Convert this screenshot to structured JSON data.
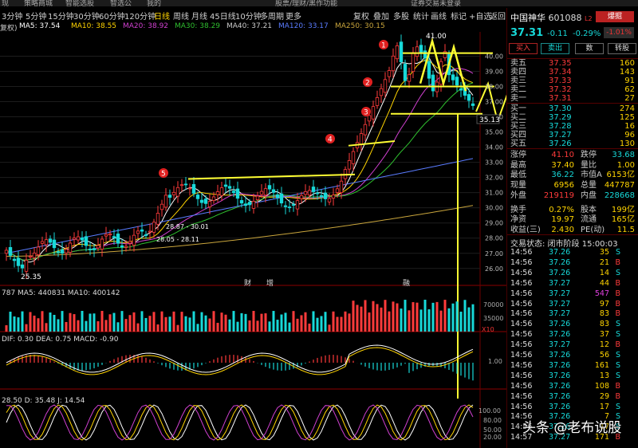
{
  "top_menu": [
    "现",
    "策略商城",
    "智能选股",
    "智选公",
    "我的",
    "股票/理财/黑作功能",
    "证券交易未登录"
  ],
  "periods": [
    "3分钟",
    "5分钟",
    "15分钟",
    "30分钟",
    "60分钟",
    "120分钟",
    "日线",
    "周线",
    "月线",
    "45日线",
    "10分钟",
    "多周期",
    "更多"
  ],
  "periods_active": "日线",
  "tools": [
    "复权",
    "叠加",
    "多股",
    "统计",
    "画线",
    "标记",
    "+自选",
    "返回"
  ],
  "ma_line": {
    "fuquan": "复权)",
    "ma5": "MA5: 37.54",
    "ma10": "MA10: 38.55",
    "ma20": "MA20: 38.92",
    "ma30": "MA30: 38.29",
    "ma40": "MA40: 37.21",
    "ma120": "MA120: 33.17",
    "ma250": "MA250: 30.15"
  },
  "chart": {
    "price_axis": [
      "40.00",
      "39.00",
      "38.00",
      "37.00",
      "36.00",
      "35.00",
      "34.00",
      "33.00",
      "32.00",
      "31.00",
      "30.00",
      "29.00",
      "28.00",
      "27.00",
      "26.00"
    ],
    "current_price_tag": "35.13",
    "high_label": "41.00",
    "low_label": "25.35",
    "range_label_1": "28.87 - 30.01",
    "range_label_2": "28.05 - 28.11",
    "event_labels": [
      "财",
      "增",
      "融"
    ],
    "markers": [
      "1",
      "2",
      "3",
      "4",
      "5"
    ],
    "vol_header": "787  MA5: 440831  MA10: 400142",
    "vol_axis": [
      "70000",
      "35000",
      "X10"
    ],
    "macd_header": "DIF: 0.30  DEA: 0.75  MACD: -0.90",
    "macd_axis": [
      "1.00"
    ],
    "kdj_header": "28.50  D: 35.48  J: 14.54",
    "kdj_axis": [
      "100.00",
      "80.00",
      "50.00",
      "20.00"
    ]
  },
  "colors": {
    "up": "#ff3b3b",
    "down": "#17d9d9",
    "annotation": "#ffff33",
    "marker": "#e02020"
  },
  "stock": {
    "name": "中国神华",
    "code": "601088",
    "level": "L2",
    "xinxi": "爆掘",
    "price": "37.31",
    "change": "-0.11",
    "pct": "-0.29%",
    "box_pct": "-1.01%"
  },
  "buttons": [
    "买入",
    "卖出",
    "数",
    "转股"
  ],
  "order_book": {
    "asks": [
      {
        "label": "卖五",
        "price": "37.35",
        "vol": "160"
      },
      {
        "label": "卖四",
        "price": "37.34",
        "vol": "143"
      },
      {
        "label": "卖三",
        "price": "37.33",
        "vol": "91"
      },
      {
        "label": "卖二",
        "price": "37.32",
        "vol": "62"
      },
      {
        "label": "卖一",
        "price": "37.31",
        "vol": "27"
      }
    ],
    "bids": [
      {
        "label": "买一",
        "price": "37.30",
        "vol": "274"
      },
      {
        "label": "买二",
        "price": "37.29",
        "vol": "125"
      },
      {
        "label": "买三",
        "price": "37.28",
        "vol": "16"
      },
      {
        "label": "买四",
        "price": "37.27",
        "vol": "96"
      },
      {
        "label": "买五",
        "price": "37.26",
        "vol": "130"
      }
    ]
  },
  "stats": [
    {
      "l1": "涨停",
      "v1": "41.10",
      "l2": "跌停",
      "v2": "33.68"
    },
    {
      "l1": "最高",
      "v1": "37.40",
      "l2": "量比",
      "v2": "1.00"
    },
    {
      "l1": "最低",
      "v1": "36.22",
      "l2": "市值A",
      "v2": "6153亿"
    },
    {
      "l1": "现量",
      "v1": "6956",
      "l2": "总量",
      "v2": "447787"
    },
    {
      "l1": "外盘",
      "v1": "219119",
      "l2": "内盘",
      "v2": "228668"
    },
    {
      "l1": "换手",
      "v1": "0.27%",
      "l2": "股本",
      "v2": "199亿"
    },
    {
      "l1": "净资",
      "v1": "19.97",
      "l2": "流通",
      "v2": "165亿"
    },
    {
      "l1": "收益(三)",
      "v1": "2.430",
      "l2": "PE(动)",
      "v2": "11.5"
    }
  ],
  "status": "交易状态: 闭市阶段 15:00:03",
  "ticks": [
    {
      "t": "14:56",
      "p": "37.26",
      "v": "35",
      "d": "S"
    },
    {
      "t": "14:56",
      "p": "37.26",
      "v": "21",
      "d": "B"
    },
    {
      "t": "14:56",
      "p": "37.26",
      "v": "14",
      "d": "S"
    },
    {
      "t": "14:56",
      "p": "37.27",
      "v": "44",
      "d": "B"
    },
    {
      "t": "14:56",
      "p": "37.27",
      "v": "547",
      "d": "B"
    },
    {
      "t": "14:56",
      "p": "37.27",
      "v": "97",
      "d": "B"
    },
    {
      "t": "14:56",
      "p": "37.27",
      "v": "83",
      "d": "B"
    },
    {
      "t": "14:56",
      "p": "37.26",
      "v": "83",
      "d": "S"
    },
    {
      "t": "14:56",
      "p": "37.26",
      "v": "37",
      "d": "S"
    },
    {
      "t": "14:56",
      "p": "37.27",
      "v": "12",
      "d": "B"
    },
    {
      "t": "14:56",
      "p": "37.26",
      "v": "56",
      "d": "S"
    },
    {
      "t": "14:56",
      "p": "37.26",
      "v": "161",
      "d": "S"
    },
    {
      "t": "14:56",
      "p": "37.26",
      "v": "13",
      "d": "S"
    },
    {
      "t": "14:56",
      "p": "37.26",
      "v": "108",
      "d": "B"
    },
    {
      "t": "14:56",
      "p": "37.26",
      "v": "29",
      "d": "B"
    },
    {
      "t": "14:56",
      "p": "37.26",
      "v": "17",
      "d": "S"
    },
    {
      "t": "14:56",
      "p": "37.26",
      "v": "7",
      "d": "S"
    },
    {
      "t": "14:56",
      "p": "37.26",
      "v": "17",
      "d": "S"
    },
    {
      "t": "14:57",
      "p": "37.27",
      "v": "171",
      "d": "B"
    }
  ],
  "watermark": "头条 @老布说股"
}
